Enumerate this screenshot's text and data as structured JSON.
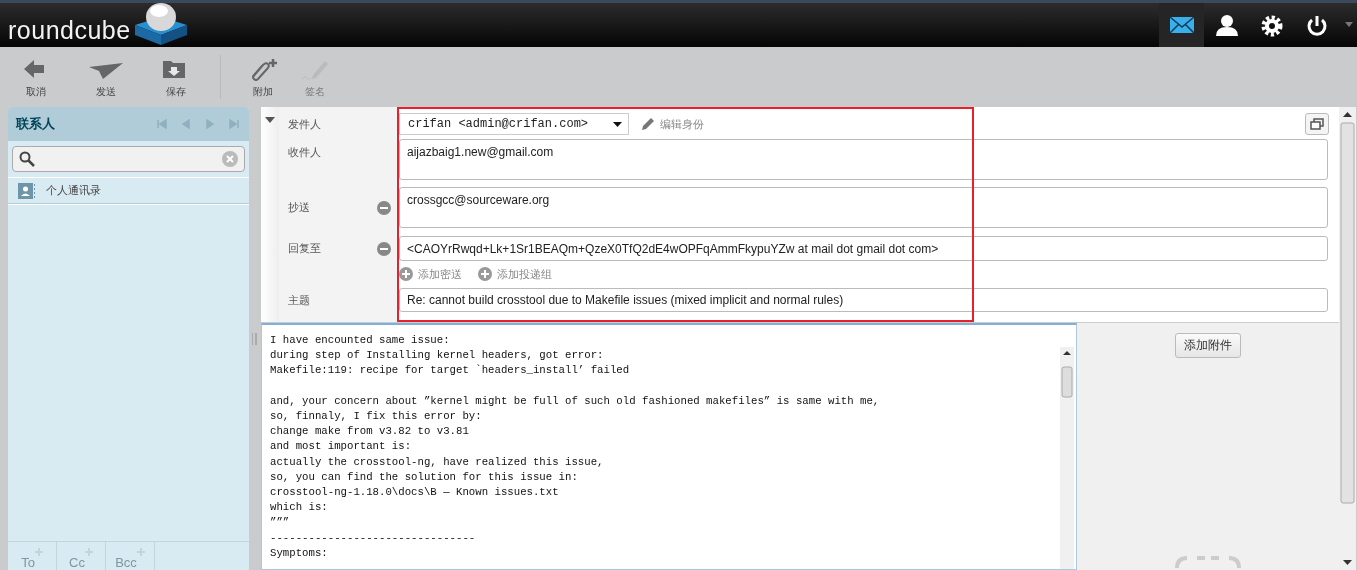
{
  "header": {
    "logo": "roundcube",
    "nav": [
      {
        "kind": "mail",
        "selected": true
      },
      {
        "kind": "user",
        "selected": false
      },
      {
        "kind": "gear",
        "selected": false
      },
      {
        "kind": "power",
        "selected": false
      }
    ]
  },
  "toolbar": [
    {
      "kind": "back",
      "label": "取消",
      "disabled": false
    },
    {
      "kind": "send",
      "label": "发送",
      "disabled": false
    },
    {
      "kind": "save",
      "label": "保存",
      "disabled": false
    },
    {
      "kind": "attach",
      "label": "附加",
      "disabled": false
    },
    {
      "kind": "sign",
      "label": "签名",
      "disabled": true
    }
  ],
  "contacts": {
    "title": "联系人",
    "items": [
      {
        "label": "个人通讯录"
      }
    ],
    "add_buttons": [
      {
        "label": "To"
      },
      {
        "label": "Cc"
      },
      {
        "label": "Bcc"
      }
    ]
  },
  "compose": {
    "from": {
      "label": "发件人",
      "value": "crifan <admin@crifan.com>",
      "edit_link": "编辑身份"
    },
    "to": {
      "label": "收件人",
      "value": "aijazbaig1.new@gmail.com"
    },
    "cc": {
      "label": "抄送",
      "value": "crossgcc@sourceware.org"
    },
    "reply_to": {
      "label": "回复至",
      "value": "<CAOYrRwqd+Lk+1Sr1BEAQm+QzeX0TfQ2dE4wOPFqAmmFkypuYZw at mail dot gmail dot com>"
    },
    "add_links": [
      "添加密送",
      "添加投递组"
    ],
    "subject": {
      "label": "主题",
      "value": "Re: cannot build crosstool due to Makefile issues (mixed implicit and normal rules)"
    },
    "body": [
      [
        "I have encounted same issue:",
        "during step of Installing kernel headers, got error:",
        "Makefile:119: recipe for target `headers_install’ failed"
      ],
      [
        "and, your concern about ”kernel might be full of such old fashioned makefiles” is same with me,",
        "so, finnaly, I fix this error by:",
        "change make from v3.82 to v3.81",
        "and most important is:",
        "actually the crosstool-ng, have realized this issue,",
        "so, you can find the solution for this issue in:",
        "crosstool-ng-1.18.0\\docs\\B — Known issues.txt",
        "which is:",
        "”””",
        "--------------------------------",
        "Symptoms:"
      ]
    ],
    "attach_button": "添加附件"
  }
}
